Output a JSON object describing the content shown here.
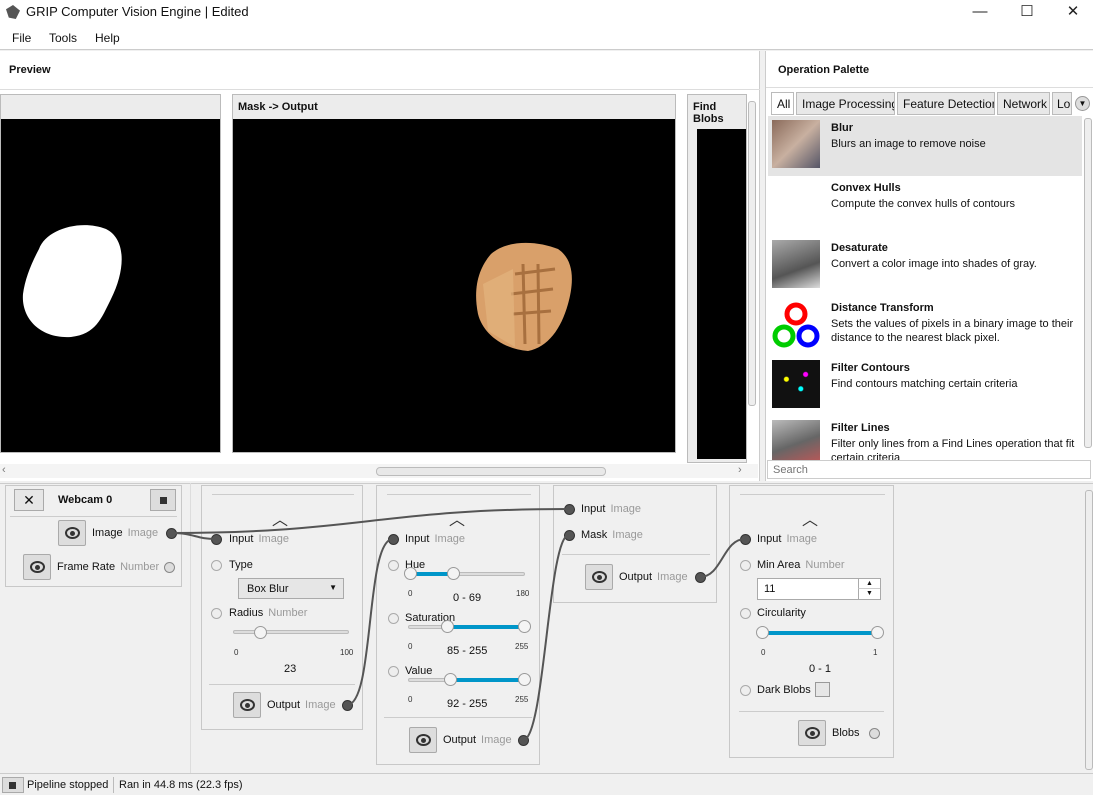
{
  "window": {
    "title": "GRIP Computer Vision Engine | Edited",
    "minimize": "—",
    "maximize": "☐",
    "close": "✕"
  },
  "menu": [
    "File",
    "Tools",
    "Help"
  ],
  "preview": {
    "title": "Preview",
    "panels": [
      "Mask -> Output",
      "Find Blobs"
    ]
  },
  "palette": {
    "title": "Operation Palette",
    "tabs": [
      "All",
      "Image Processing",
      "Feature Detection",
      "Network",
      "Lo"
    ],
    "items": [
      {
        "name": "Blur",
        "desc": "Blurs an image to remove noise"
      },
      {
        "name": "Convex Hulls",
        "desc": "Compute the convex hulls of contours"
      },
      {
        "name": "Desaturate",
        "desc": "Convert a color image into shades of gray."
      },
      {
        "name": "Distance Transform",
        "desc": "Sets the values of pixels in a binary image to their distance to the nearest black pixel."
      },
      {
        "name": "Filter Contours",
        "desc": "Find contours matching certain criteria"
      },
      {
        "name": "Filter Lines",
        "desc": "Filter only lines from a Find Lines operation that fit certain criteria"
      }
    ],
    "search_placeholder": "Search"
  },
  "source": {
    "name": "Webcam 0",
    "image": "Image",
    "image_type": "Image",
    "framerate": "Frame Rate",
    "framerate_type": "Number"
  },
  "blur": {
    "input": "Input",
    "input_type": "Image",
    "type_label": "Type",
    "type_value": "Box Blur",
    "radius": "Radius",
    "radius_type": "Number",
    "radius_min": "0",
    "radius_max": "100",
    "radius_value": "23",
    "radius_fraction": 0.23,
    "output": "Output",
    "output_type": "Image"
  },
  "hsv": {
    "input": "Input",
    "input_type": "Image",
    "hue": "Hue",
    "hue_min": "0",
    "hue_max": "180",
    "hue_value": "0 - 69",
    "sat": "Saturation",
    "sat_min": "0",
    "sat_max": "255",
    "sat_value": "85 - 255",
    "val": "Value",
    "val_min": "0",
    "val_max": "255",
    "val_value": "92 - 255",
    "output": "Output",
    "output_type": "Image"
  },
  "mask": {
    "input": "Input",
    "input_type": "Image",
    "mask": "Mask",
    "mask_type": "Image",
    "output": "Output",
    "output_type": "Image"
  },
  "blobs": {
    "input": "Input",
    "input_type": "Image",
    "minarea": "Min Area",
    "minarea_type": "Number",
    "minarea_value": "11",
    "circ": "Circularity",
    "circ_min": "0",
    "circ_max": "1",
    "circ_value": "0 - 1",
    "dark": "Dark Blobs",
    "output": "Blobs"
  },
  "status": {
    "pipeline": "Pipeline stopped",
    "ran": "Ran in 44.8 ms (22.3 fps)"
  }
}
